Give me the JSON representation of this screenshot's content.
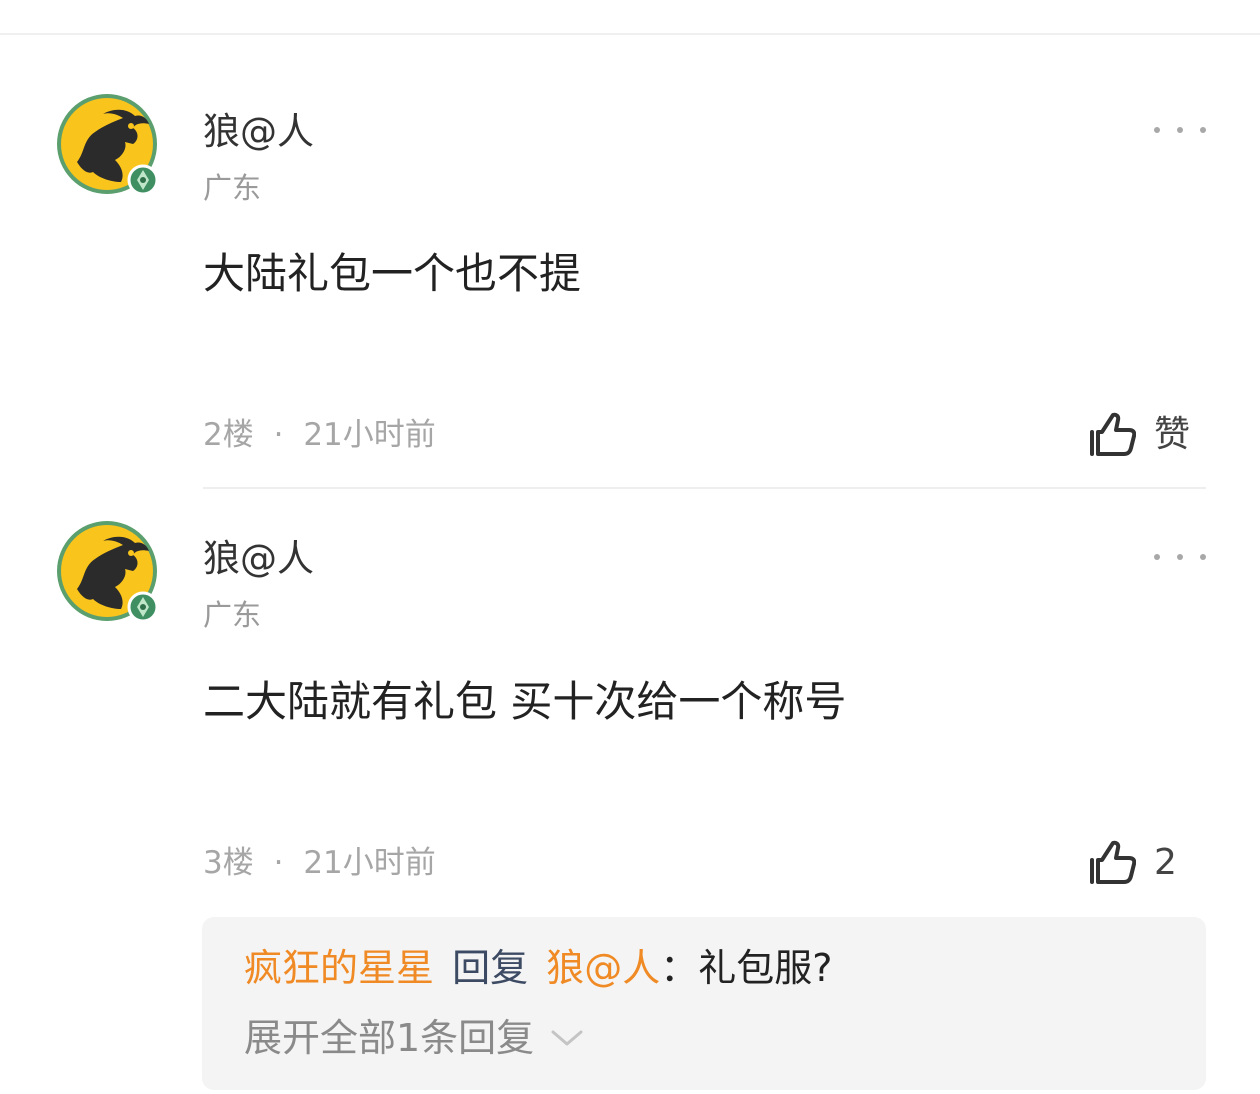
{
  "comments": [
    {
      "username": "狼@人",
      "location": "广东",
      "content": "大陆礼包一个也不提",
      "floor": "2楼",
      "separator": "·",
      "time": "21小时前",
      "like_label": "赞"
    },
    {
      "username": "狼@人",
      "location": "广东",
      "content": "二大陆就有礼包 买十次给一个称号",
      "floor": "3楼",
      "separator": "·",
      "time": "21小时前",
      "like_label": "2"
    }
  ],
  "reply": {
    "author": "疯狂的星星",
    "action": "回复",
    "target": "狼@人",
    "colon": "：",
    "text": "礼包服?",
    "expand_label": "展开全部1条回复"
  },
  "icons": {
    "avatar": "dragon-avatar",
    "badge": "level-badge-icon",
    "more": "more-dots-icon",
    "like": "thumbs-up-icon",
    "expand": "chevron-down-icon"
  },
  "colors": {
    "reply_author": "#f08a24",
    "reply_action": "#3d4a63",
    "avatar_yellow": "#f9c41c",
    "avatar_ring": "#5c9f6e"
  }
}
